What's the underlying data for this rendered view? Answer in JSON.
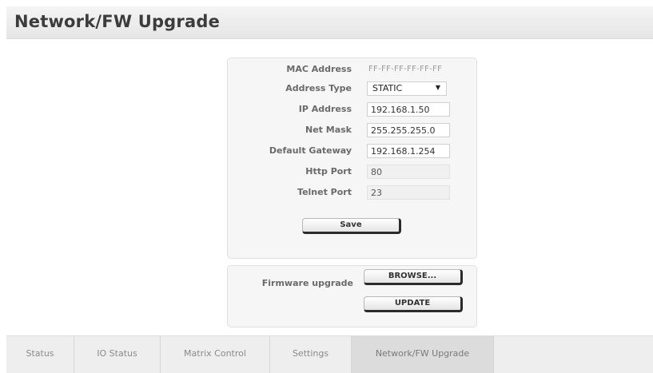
{
  "page": {
    "title": "Network/FW Upgrade"
  },
  "network": {
    "mac_label": "MAC Address",
    "mac_value": "FF-FF-FF-FF-FF-FF",
    "address_type_label": "Address Type",
    "address_type_value": "STATIC",
    "ip_label": "IP Address",
    "ip_value": "192.168.1.50",
    "netmask_label": "Net Mask",
    "netmask_value": "255.255.255.0",
    "gateway_label": "Default Gateway",
    "gateway_value": "192.168.1.254",
    "http_port_label": "Http Port",
    "http_port_value": "80",
    "telnet_port_label": "Telnet Port",
    "telnet_port_value": "23",
    "save_label": "Save"
  },
  "firmware": {
    "label": "Firmware upgrade",
    "browse_label": "BROWSE...",
    "update_label": "UPDATE"
  },
  "tabs": [
    {
      "label": "Status"
    },
    {
      "label": "IO Status"
    },
    {
      "label": "Matrix Control"
    },
    {
      "label": "Settings"
    },
    {
      "label": "Network/FW Upgrade",
      "active": true
    }
  ],
  "icons": {
    "dropdown": "caret-down-icon"
  }
}
